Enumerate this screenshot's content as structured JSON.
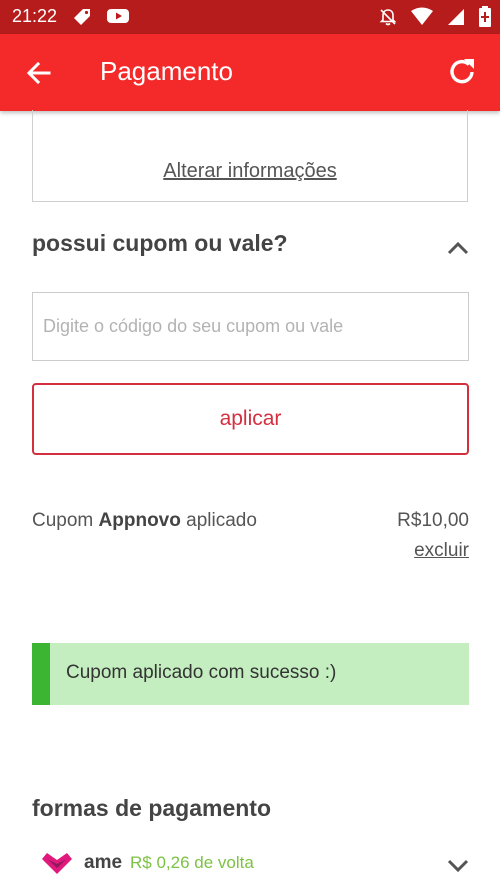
{
  "status_bar": {
    "time": "21:22",
    "icons": [
      "tag-icon",
      "youtube-icon",
      "notifications-off-icon",
      "wifi-icon",
      "signal-icon",
      "battery-icon"
    ]
  },
  "app_bar": {
    "title": "Pagamento",
    "back_icon": "arrow-left-icon",
    "refresh_icon": "refresh-icon"
  },
  "address": {
    "alter_link": "Alterar informações"
  },
  "coupon": {
    "title": "possui cupom ou vale?",
    "input_placeholder": "Digite o código do seu cupom ou vale",
    "input_value": "",
    "apply_label": "aplicar",
    "applied_prefix": "Cupom",
    "applied_code": "Appnovo",
    "applied_suffix": "aplicado",
    "applied_value": "R$10,00",
    "remove_label": "excluir"
  },
  "success_message": "Cupom aplicado com sucesso :)",
  "payment": {
    "title": "formas de pagamento",
    "ame_label": "ame",
    "ame_cashback": "R$ 0,26 de volta"
  },
  "colors": {
    "status_bar": "#b71c1c",
    "app_bar": "#f42a2a",
    "accent": "#d32f3f",
    "success_bg": "#c4eec0",
    "success_bar": "#3cb632",
    "cashback": "#7cc243",
    "ame_brand": "#e0197d"
  }
}
